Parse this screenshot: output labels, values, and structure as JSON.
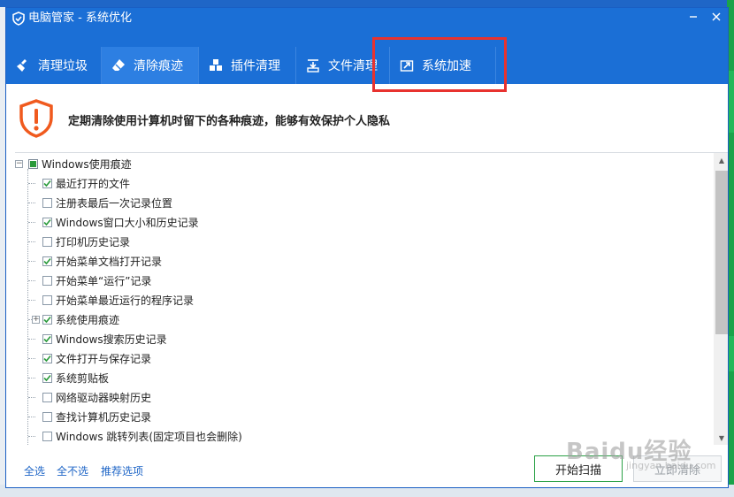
{
  "window": {
    "title": "电脑管家 - 系统优化",
    "controls": [
      "minimize-icon",
      "close-icon"
    ]
  },
  "tabs": [
    {
      "label": "清理垃圾",
      "icon": "broom-icon",
      "active": false
    },
    {
      "label": "清除痕迹",
      "icon": "eraser-icon",
      "active": true
    },
    {
      "label": "插件清理",
      "icon": "blocks-icon",
      "active": false
    },
    {
      "label": "文件清理",
      "icon": "file-clean-icon",
      "active": false
    },
    {
      "label": "系统加速",
      "icon": "speedup-icon",
      "active": false
    }
  ],
  "banner": {
    "icon": "warning-shield-icon",
    "text": "定期清除使用计算机时留下的各种痕迹，能够有效保护个人隐私"
  },
  "tree": {
    "root": {
      "label": "Windows使用痕迹",
      "expanded": true,
      "state": "partial"
    },
    "items": [
      {
        "label": "最近打开的文件",
        "checked": true,
        "expandable": false
      },
      {
        "label": "注册表最后一次记录位置",
        "checked": false,
        "expandable": false
      },
      {
        "label": "Windows窗口大小和历史记录",
        "checked": true,
        "expandable": false
      },
      {
        "label": "打印机历史记录",
        "checked": false,
        "expandable": false
      },
      {
        "label": "开始菜单文档打开记录",
        "checked": true,
        "expandable": false
      },
      {
        "label": "开始菜单“运行”记录",
        "checked": false,
        "expandable": false
      },
      {
        "label": "开始菜单最近运行的程序记录",
        "checked": false,
        "expandable": false
      },
      {
        "label": "系统使用痕迹",
        "checked": true,
        "expandable": true
      },
      {
        "label": "Windows搜索历史记录",
        "checked": true,
        "expandable": false
      },
      {
        "label": "文件打开与保存记录",
        "checked": true,
        "expandable": false
      },
      {
        "label": "系统剪贴板",
        "checked": true,
        "expandable": false
      },
      {
        "label": "网络驱动器映射历史",
        "checked": false,
        "expandable": false
      },
      {
        "label": "查找计算机历史记录",
        "checked": false,
        "expandable": false
      },
      {
        "label": "Windows 跳转列表(固定项目也会删除)",
        "checked": false,
        "expandable": false
      }
    ]
  },
  "footer": {
    "select_all": "全选",
    "select_none": "全不选",
    "recommended": "推荐选项",
    "scan_button": "开始扫描",
    "clean_button": "立即清除"
  },
  "watermark": {
    "text": "Baidu经验",
    "sub": "jingyan.baidu.com"
  },
  "colors": {
    "brand_blue": "#1b6fd6",
    "active_tab": "#2d7fe2",
    "highlight_red": "#e8322f",
    "check_green": "#2a9a3b",
    "warn_orange": "#f05a1e"
  }
}
